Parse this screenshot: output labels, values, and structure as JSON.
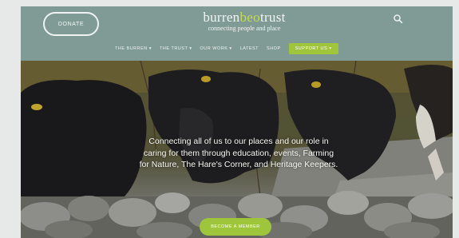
{
  "header": {
    "donate_label": "DONATE",
    "logo": {
      "word_start": "burren",
      "word_accent": "beo",
      "word_end": "trust",
      "tagline": "connecting people and place"
    },
    "icons": {
      "search": "search-icon"
    }
  },
  "nav": {
    "items": [
      "THE BURREN ▾",
      "THE TRUST ▾",
      "OUR WORK ▾",
      "LATEST",
      "SHOP"
    ],
    "support_label": "SUPPORT US ▾"
  },
  "hero": {
    "caption": "Connecting all of us to our places and our role in caring for them through education, events, Farming for Nature, The Hare's Corner, and Heritage Keepers.",
    "cta_label": "BECOME A MEMBER"
  },
  "colors": {
    "header_bg": "#809b95",
    "accent_green": "#9fc63a",
    "logo_accent": "#c3dc4f"
  }
}
